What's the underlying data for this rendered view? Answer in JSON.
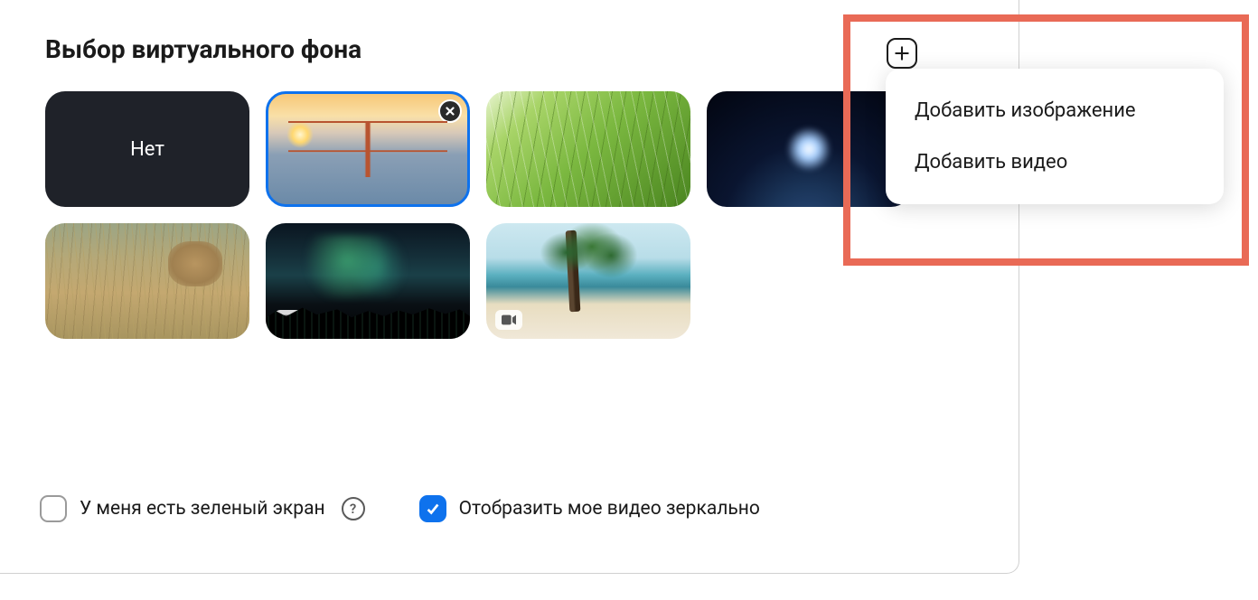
{
  "title": "Выбор виртуального фона",
  "tiles": {
    "none_label": "Нет"
  },
  "dropdown": {
    "add_image": "Добавить изображение",
    "add_video": "Добавить видео"
  },
  "options": {
    "green_screen": "У меня есть зеленый экран",
    "mirror_video": "Отобразить мое видео зеркально"
  },
  "icons": {
    "help": "?"
  }
}
